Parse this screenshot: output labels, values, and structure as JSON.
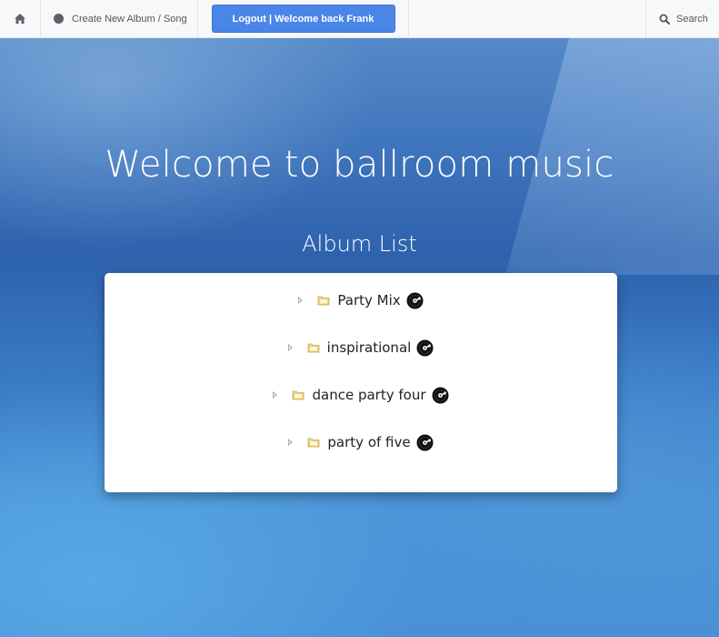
{
  "navbar": {
    "home_icon": "home-icon",
    "create_label": "Create New Album / Song",
    "logout_label": "Logout | Welcome back Frank",
    "search_label": "Search",
    "search_icon": "search-icon"
  },
  "main": {
    "title": "Welcome to ballroom music",
    "subtitle": "Album List"
  },
  "albums": [
    {
      "label": "Party Mix",
      "icon": "folder-icon",
      "badge_icon": "vinyl-record-icon"
    },
    {
      "label": "inspirational",
      "icon": "folder-icon",
      "badge_icon": "vinyl-record-icon"
    },
    {
      "label": "dance party four",
      "icon": "folder-icon",
      "badge_icon": "vinyl-record-icon"
    },
    {
      "label": "party of five",
      "icon": "folder-icon",
      "badge_icon": "vinyl-record-icon"
    }
  ],
  "colors": {
    "accent": "#4a86e8",
    "navbar_bg": "#f7f8fa",
    "background_blue": "#3a74bd"
  }
}
